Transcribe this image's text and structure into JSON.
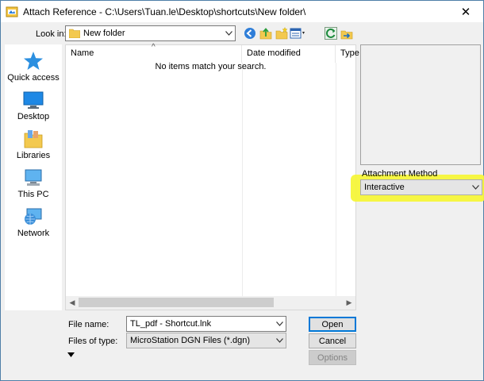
{
  "window": {
    "title": "Attach Reference - C:\\Users\\Tuan.le\\Desktop\\shortcuts\\New folder\\",
    "close_glyph": "✕"
  },
  "look_in": {
    "label": "Look in:",
    "value": "New folder"
  },
  "toolbar": {
    "icons": [
      "back-icon",
      "up-folder-icon",
      "new-folder-icon",
      "view-menu-icon",
      "refresh-icon",
      "folder-arrow-icon"
    ]
  },
  "places": [
    {
      "label": "Quick access",
      "icon": "star-icon"
    },
    {
      "label": "Desktop",
      "icon": "desktop-icon"
    },
    {
      "label": "Libraries",
      "icon": "libraries-icon"
    },
    {
      "label": "This PC",
      "icon": "pc-icon"
    },
    {
      "label": "Network",
      "icon": "network-icon"
    }
  ],
  "file_list": {
    "columns": [
      "Name",
      "Date modified",
      "Type"
    ],
    "empty_message": "No items match your search.",
    "sort_glyph": "^"
  },
  "attachment": {
    "label": "Attachment Method",
    "value": "Interactive"
  },
  "file_name": {
    "label": "File name:",
    "value": "TL_pdf - Shortcut.lnk"
  },
  "files_of_type": {
    "label": "Files of type:",
    "value": "MicroStation DGN Files (*.dgn)"
  },
  "buttons": {
    "open": "Open",
    "cancel": "Cancel",
    "options": "Options"
  },
  "colors": {
    "highlight": "#f6f63a",
    "accent": "#0078d7"
  }
}
